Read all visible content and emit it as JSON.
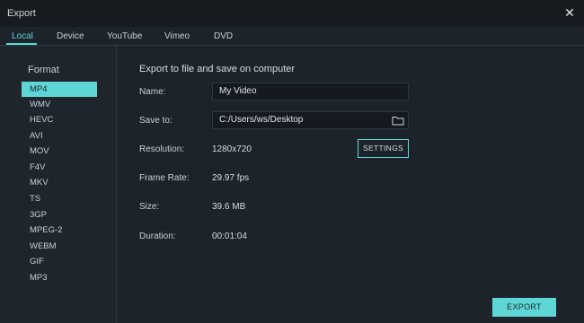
{
  "window": {
    "title": "Export",
    "close_symbol": "✕"
  },
  "tabs": [
    {
      "label": "Local",
      "active": true
    },
    {
      "label": "Device"
    },
    {
      "label": "YouTube"
    },
    {
      "label": "Vimeo"
    },
    {
      "label": "DVD"
    }
  ],
  "sidebar": {
    "heading": "Format",
    "formats": [
      "MP4",
      "WMV",
      "HEVC",
      "AVI",
      "MOV",
      "F4V",
      "MKV",
      "TS",
      "3GP",
      "MPEG-2",
      "WEBM",
      "GIF",
      "MP3"
    ],
    "selected": "MP4"
  },
  "main": {
    "heading": "Export to file and save on computer",
    "name_label": "Name:",
    "name_value": "My Video",
    "save_to_label": "Save to:",
    "save_to_value": "C:/Users/ws/Desktop",
    "resolution_label": "Resolution:",
    "resolution_value": "1280x720",
    "settings_label": "SETTINGS",
    "frame_rate_label": "Frame Rate:",
    "frame_rate_value": "29.97 fps",
    "size_label": "Size:",
    "size_value": "39.6 MB",
    "duration_label": "Duration:",
    "duration_value": "00:01:04",
    "export_label": "EXPORT"
  },
  "colors": {
    "accent": "#5fd6d6",
    "background": "#1c232b",
    "titlebar": "#161b20"
  },
  "icons": {
    "folder": "folder-icon",
    "close": "close-icon"
  }
}
